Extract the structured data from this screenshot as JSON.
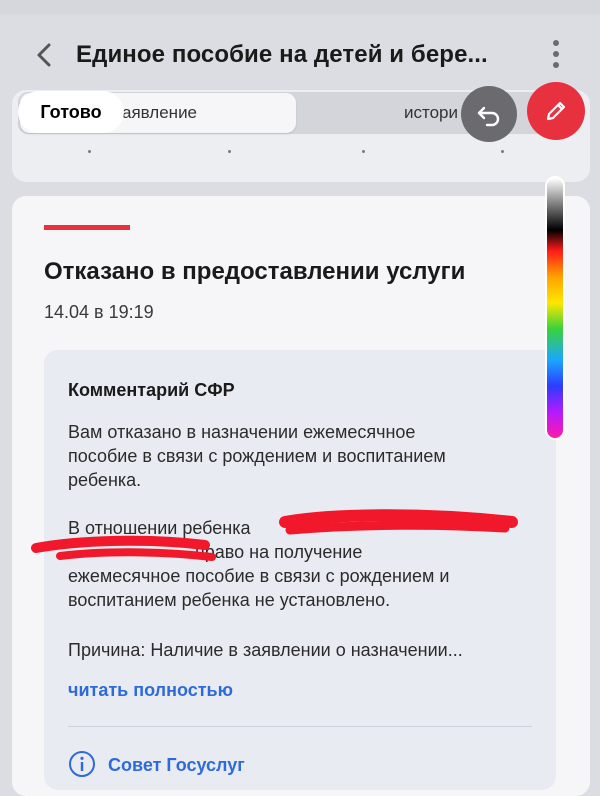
{
  "header": {
    "title": "Единое пособие на детей и бере..."
  },
  "tabs": [
    {
      "label": "аявление"
    },
    {
      "label": "истори"
    }
  ],
  "markup_toolbar": {
    "done_label": "Готово"
  },
  "status_card": {
    "title": "Отказано в предоставлении услуги",
    "date": "14.04 в 19:19"
  },
  "comment": {
    "title": "Комментарий СФР",
    "lines": [
      "Вам отказано в назначении ежемесячное",
      "пособие в связи с рождением и воспитанием",
      "ребенка.",
      "В отношении ребенка",
      "право на получение",
      "ежемесячное пособие в связи с рождением и",
      "воспитанием ребенка не установлено.",
      "Причина: Наличие в заявлении о назначении..."
    ],
    "read_more": "читать полностью"
  },
  "tip": {
    "label": "Совет Госуслуг"
  },
  "colors": {
    "accent_red": "#e8313f",
    "link_blue": "#2f6ad9"
  },
  "icons": {
    "back": "chevron-left-icon",
    "more": "more-vertical-icon",
    "undo": "undo-icon",
    "pen": "pencil-icon",
    "info": "info-icon"
  }
}
